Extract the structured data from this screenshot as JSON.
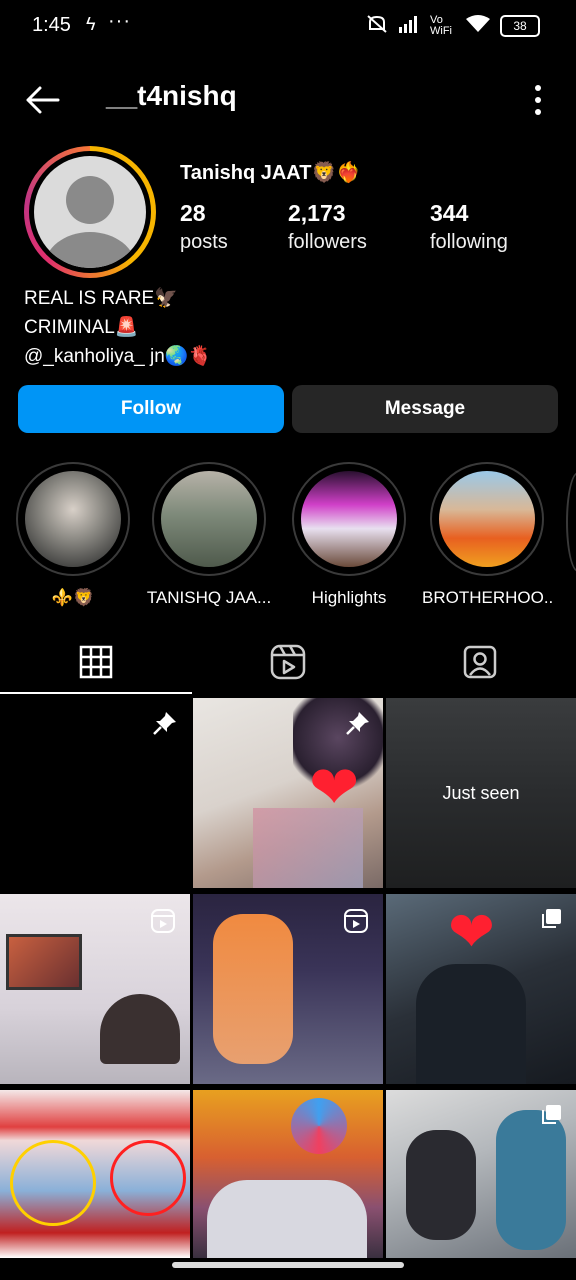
{
  "status_bar": {
    "time": "1:45",
    "network_label": "Vo WiFi",
    "battery": "38"
  },
  "header": {
    "username": "__t4nishq"
  },
  "profile": {
    "display_name": "Tanishq JAAT🦁❤️‍🔥",
    "stats": [
      {
        "value": "28",
        "label": "posts"
      },
      {
        "value": "2,173",
        "label": "followers"
      },
      {
        "value": "344",
        "label": "following"
      }
    ],
    "bio": [
      "REAL IS RARE🦅",
      "CRIMINAL🚨",
      "@_kanholiya_ jn🌏🫀"
    ]
  },
  "actions": {
    "follow_label": "Follow",
    "message_label": "Message"
  },
  "highlights": [
    {
      "label": "⚜️🦁"
    },
    {
      "label": "TANISHQ JAA..."
    },
    {
      "label": "Highlights"
    },
    {
      "label": "BROTHERHOO..."
    }
  ],
  "grid": {
    "just_seen_label": "Just seen"
  },
  "colors": {
    "follow": "#0095f6",
    "message": "#262626",
    "background": "#000000"
  }
}
